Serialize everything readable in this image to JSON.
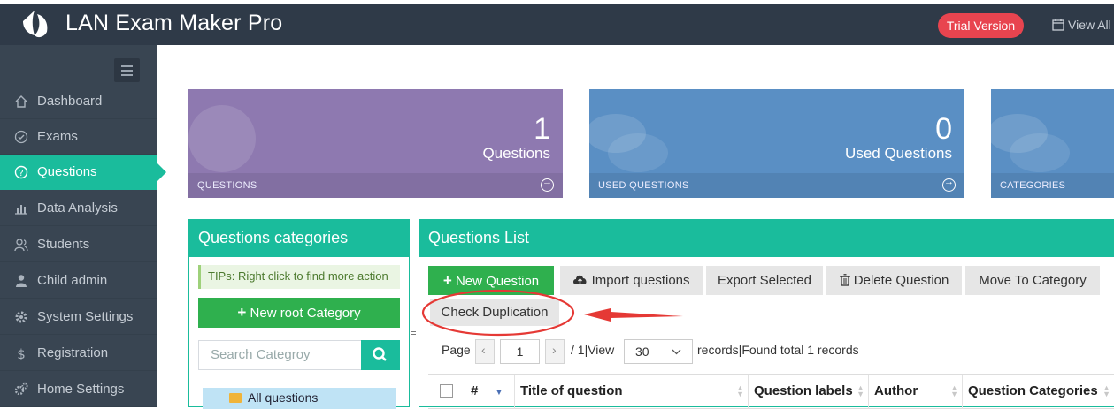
{
  "header": {
    "app_title": "LAN Exam Maker Pro",
    "trial_badge": "Trial Version",
    "view_all": "View All"
  },
  "sidebar": {
    "items": [
      {
        "label": "Dashboard",
        "icon": "home-icon"
      },
      {
        "label": "Exams",
        "icon": "check-circle-icon"
      },
      {
        "label": "Questions",
        "icon": "question-circle-icon",
        "active": true
      },
      {
        "label": "Data Analysis",
        "icon": "bar-chart-icon"
      },
      {
        "label": "Students",
        "icon": "users-icon"
      },
      {
        "label": "Child admin",
        "icon": "user-icon"
      },
      {
        "label": "System Settings",
        "icon": "gear-icon"
      },
      {
        "label": "Registration",
        "icon": "dollar-icon"
      },
      {
        "label": "Home Settings",
        "icon": "gears-icon"
      }
    ]
  },
  "stats": [
    {
      "value": "1",
      "label": "Questions",
      "footer": "QUESTIONS",
      "color": "#8e79b0"
    },
    {
      "value": "0",
      "label": "Used Questions",
      "footer": "USED QUESTIONS",
      "color": "#5a8fc4"
    },
    {
      "value": "",
      "label": "",
      "footer": "CATEGORIES",
      "color": "#5a8fc4"
    }
  ],
  "categories_panel": {
    "title": "Questions categories",
    "tips": "TIPs:  Right click to find more action",
    "new_root_button": "New root Category",
    "search_placeholder": "Search Categroy",
    "tree_root": "All questions"
  },
  "list_panel": {
    "title": "Questions List",
    "toolbar": {
      "new_question": "New Question",
      "import_questions": "Import questions",
      "export_selected": "Export Selected",
      "delete_question": "Delete Question",
      "move_to_category": "Move To Category",
      "check_duplication": "Check Duplication"
    },
    "pager": {
      "page_label": "Page",
      "page_value": "1",
      "of_pages": "/ 1|View",
      "per_page": "30",
      "records_text": "records|Found total 1 records"
    },
    "columns": [
      "#",
      "Title of question",
      "Question labels",
      "Author",
      "Question Categories"
    ]
  },
  "colors": {
    "header_bg": "#2f3a48",
    "sidebar_bg": "#394552",
    "accent": "#1abc9c",
    "green_button": "#2fb04e",
    "badge_red": "#e8444f",
    "annotation_red": "#e53935"
  }
}
